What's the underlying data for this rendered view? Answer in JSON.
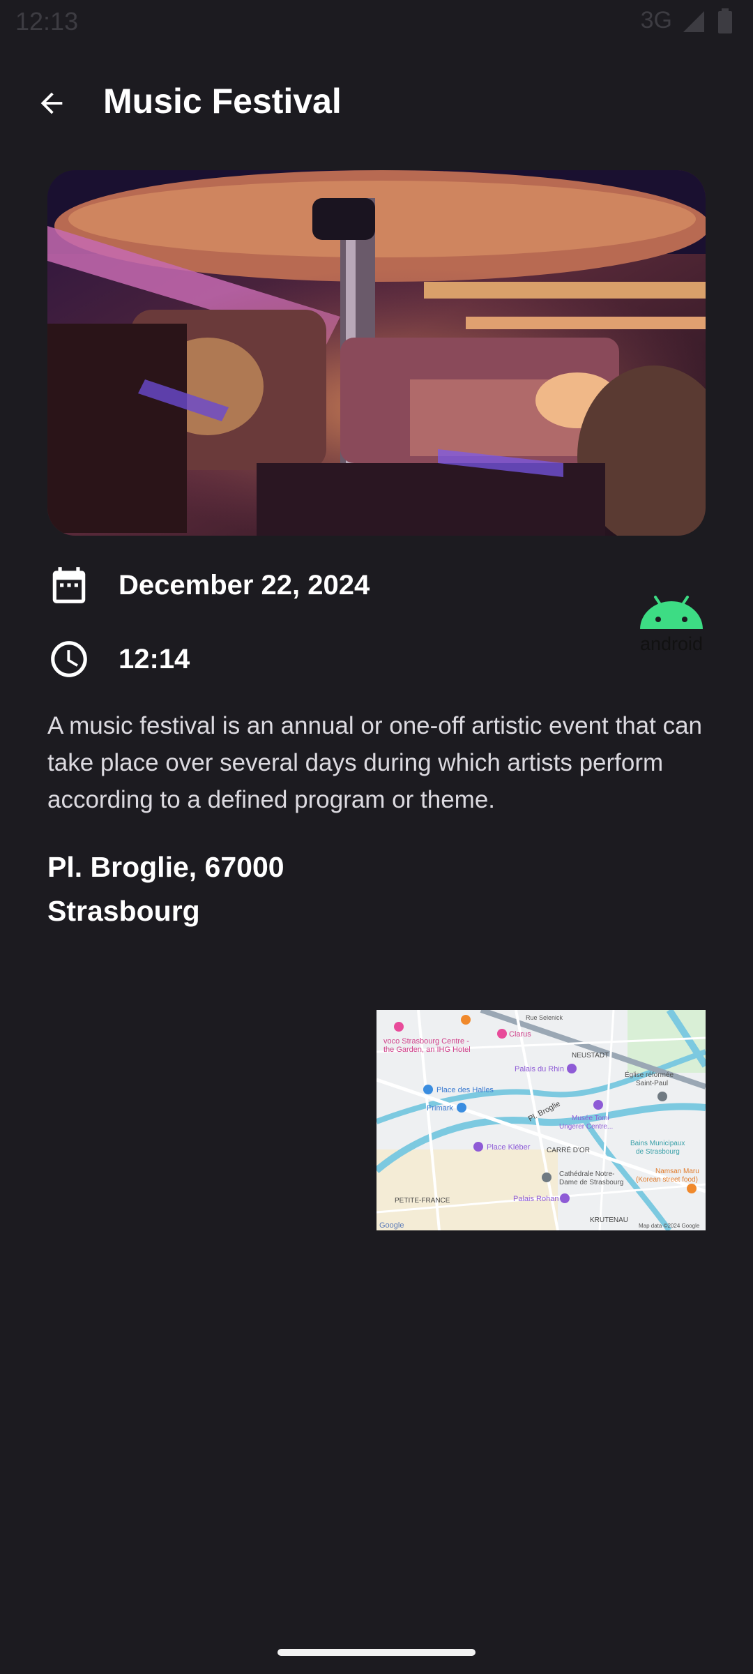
{
  "status_bar": {
    "time": "12:13",
    "network": "3G"
  },
  "app_bar": {
    "title": "Music Festival"
  },
  "event": {
    "date": "December 22, 2024",
    "time": "12:14",
    "description": "A music festival is an annual or one-off artistic event that can take place over several days during which artists perform according to a defined program or theme.",
    "address_line1": "Pl. Broglie, 67000",
    "address_line2": "Strasbourg"
  },
  "branding": {
    "android_logo_text": "android"
  },
  "map": {
    "labels": {
      "rue_selenick": "Rue Selenick",
      "voco": "voco Strasbourg Centre -",
      "voco2": "the Garden, an IHG Hotel",
      "clarus": "Clarus",
      "neustadt": "NEUSTADT",
      "palais_rhin": "Palais du Rhin",
      "eglise": "Église réformée",
      "eglise2": "Saint-Paul",
      "place_halles": "Place des Halles",
      "primark": "Primark",
      "pl_broglie": "Pl. Broglie",
      "musee": "Musée Tomi",
      "musee2": "Ungerer Centre...",
      "place_kleber": "Place Kléber",
      "carre_or": "CARRÉ D'OR",
      "bains": "Bains Municipaux",
      "bains2": "de Strasbourg",
      "namsan": "Namsan Maru",
      "namsan2": "(Korean street food)",
      "cathedrale": "Cathédrale Notre-",
      "cathedrale2": "Dame de Strasbourg",
      "petite_france": "PETITE-FRANCE",
      "palais_rohan": "Palais Rohan",
      "krutenau": "KRUTENAU",
      "google": "Google",
      "map_data": "Map data ©2024 Google"
    }
  },
  "colors": {
    "background": "#1c1b20",
    "text": "#ffffff",
    "android_green": "#3ddc84",
    "map_road": "#ffffff",
    "map_water": "#7cc9e0"
  }
}
